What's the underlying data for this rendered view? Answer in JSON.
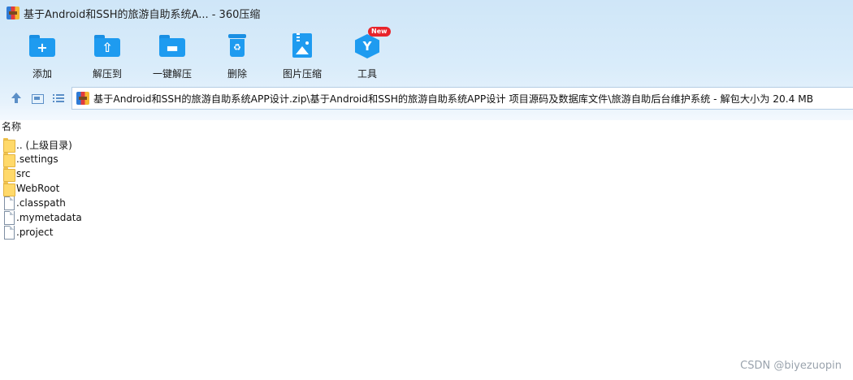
{
  "window": {
    "title": "基于Android和SSH的旅游自助系统A... - 360压缩"
  },
  "toolbar": {
    "items": [
      {
        "label": "添加",
        "icon": "add-folder-icon"
      },
      {
        "label": "解压到",
        "icon": "extract-to-icon"
      },
      {
        "label": "一键解压",
        "icon": "one-click-extract-icon"
      },
      {
        "label": "删除",
        "icon": "trash-icon"
      },
      {
        "label": "图片压缩",
        "icon": "image-compress-icon"
      },
      {
        "label": "工具",
        "icon": "tools-icon",
        "badge": "New"
      }
    ]
  },
  "address": {
    "path": "基于Android和SSH的旅游自助系统APP设计.zip\\基于Android和SSH的旅游自助系统APP设计 项目源码及数据库文件\\旅游自助后台维护系统 - 解包大小为 20.4 MB"
  },
  "file_list": {
    "column_header": "名称",
    "items": [
      {
        "name": ".. (上级目录)",
        "type": "folder"
      },
      {
        "name": ".settings",
        "type": "folder"
      },
      {
        "name": "src",
        "type": "folder"
      },
      {
        "name": "WebRoot",
        "type": "folder"
      },
      {
        "name": ".classpath",
        "type": "file"
      },
      {
        "name": ".mymetadata",
        "type": "file"
      },
      {
        "name": ".project",
        "type": "file"
      }
    ]
  },
  "watermark": "CSDN @biyezuopin",
  "colors": {
    "header_bg": "#d9ecfa",
    "icon_blue": "#1e9bf0",
    "badge_red": "#e8242b",
    "folder_yellow": "#ffd96a"
  }
}
